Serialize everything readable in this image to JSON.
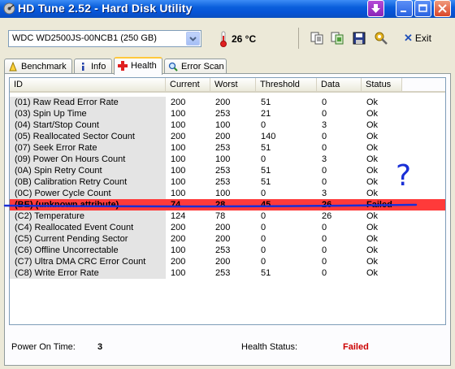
{
  "window": {
    "title": "HD Tune 2.52 - Hard Disk Utility"
  },
  "toolbar": {
    "drive": "WDC WD2500JS-00NCB1 (250 GB)",
    "temperature": "26 °C",
    "exit_label": "Exit",
    "icons": [
      "copy-text-icon",
      "copy-screenshot-icon",
      "save-icon",
      "options-icon"
    ]
  },
  "tabs": [
    {
      "label": "Benchmark",
      "icon": "benchmark-icon"
    },
    {
      "label": "Info",
      "icon": "info-icon"
    },
    {
      "label": "Health",
      "icon": "health-cross-icon",
      "active": true
    },
    {
      "label": "Error Scan",
      "icon": "magnifier-icon"
    }
  ],
  "columns": [
    "ID",
    "Current",
    "Worst",
    "Threshold",
    "Data",
    "Status"
  ],
  "rows": [
    [
      "(01) Raw Read Error Rate",
      "200",
      "200",
      "51",
      "0",
      "Ok"
    ],
    [
      "(03) Spin Up Time",
      "100",
      "253",
      "21",
      "0",
      "Ok"
    ],
    [
      "(04) Start/Stop Count",
      "100",
      "100",
      "0",
      "3",
      "Ok"
    ],
    [
      "(05) Reallocated Sector Count",
      "200",
      "200",
      "140",
      "0",
      "Ok"
    ],
    [
      "(07) Seek Error Rate",
      "100",
      "253",
      "51",
      "0",
      "Ok"
    ],
    [
      "(09) Power On Hours Count",
      "100",
      "100",
      "0",
      "3",
      "Ok"
    ],
    [
      "(0A) Spin Retry Count",
      "100",
      "253",
      "51",
      "0",
      "Ok"
    ],
    [
      "(0B) Calibration Retry Count",
      "100",
      "253",
      "51",
      "0",
      "Ok"
    ],
    [
      "(0C) Power Cycle Count",
      "100",
      "100",
      "0",
      "3",
      "Ok"
    ],
    [
      "(BE) (unknown attribute)",
      "74",
      "28",
      "45",
      "26",
      "Failed"
    ],
    [
      "(C2) Temperature",
      "124",
      "78",
      "0",
      "26",
      "Ok"
    ],
    [
      "(C4) Reallocated Event Count",
      "200",
      "200",
      "0",
      "0",
      "Ok"
    ],
    [
      "(C5) Current Pending Sector",
      "200",
      "200",
      "0",
      "0",
      "Ok"
    ],
    [
      "(C6) Offline Uncorrectable",
      "100",
      "253",
      "0",
      "0",
      "Ok"
    ],
    [
      "(C7) Ultra DMA CRC Error Count",
      "200",
      "200",
      "0",
      "0",
      "Ok"
    ],
    [
      "(C8) Write Error Rate",
      "100",
      "253",
      "51",
      "0",
      "Ok"
    ]
  ],
  "annotation": {
    "mark": "?",
    "color": "#1a2fd6"
  },
  "footer": {
    "power_on_label": "Power On Time:",
    "power_on_value": "3",
    "health_label": "Health Status:",
    "health_value": "Failed"
  },
  "colors": {
    "failed_row": "#ff3a3a",
    "failed_text": "#cc0000",
    "title_bar": "#0653d6"
  }
}
